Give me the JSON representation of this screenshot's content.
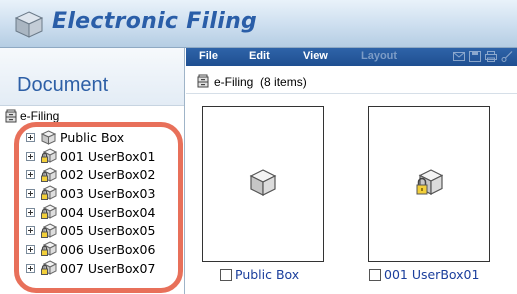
{
  "app": {
    "title": "Electronic Filing",
    "logo_icon": "cube-logo-icon"
  },
  "left_panel": {
    "title": "Document",
    "root": {
      "label": "e-Filing",
      "icon": "filing-cabinet-icon"
    },
    "tree": [
      {
        "label": "Public Box",
        "icon": "public-box-icon",
        "locked": false
      },
      {
        "label": "001 UserBox01",
        "icon": "locked-box-icon",
        "locked": true
      },
      {
        "label": "002 UserBox02",
        "icon": "locked-box-icon",
        "locked": true
      },
      {
        "label": "003 UserBox03",
        "icon": "locked-box-icon",
        "locked": true
      },
      {
        "label": "004 UserBox04",
        "icon": "locked-box-icon",
        "locked": true
      },
      {
        "label": "005 UserBox05",
        "icon": "locked-box-icon",
        "locked": true
      },
      {
        "label": "006 UserBox06",
        "icon": "locked-box-icon",
        "locked": true
      },
      {
        "label": "007 UserBox07",
        "icon": "locked-box-icon",
        "locked": true
      }
    ],
    "highlight_color": "#e8705a"
  },
  "menubar": {
    "items": [
      {
        "label": "File",
        "enabled": true
      },
      {
        "label": "Edit",
        "enabled": true
      },
      {
        "label": "View",
        "enabled": true
      },
      {
        "label": "Layout",
        "enabled": false
      }
    ],
    "tool_icons": [
      "mail-icon",
      "save-icon",
      "print-icon",
      "cut-icon"
    ]
  },
  "path_bar": {
    "label": "e-Filing",
    "count": "(8 items)"
  },
  "cards": [
    {
      "label": "Public Box",
      "icon": "public-box-icon"
    },
    {
      "label": "001 UserBox01",
      "icon": "locked-box-icon"
    }
  ],
  "colors": {
    "title_text": "#2a5ea8",
    "menubar": "#2e63a8",
    "link_text": "#1a3e9c"
  }
}
